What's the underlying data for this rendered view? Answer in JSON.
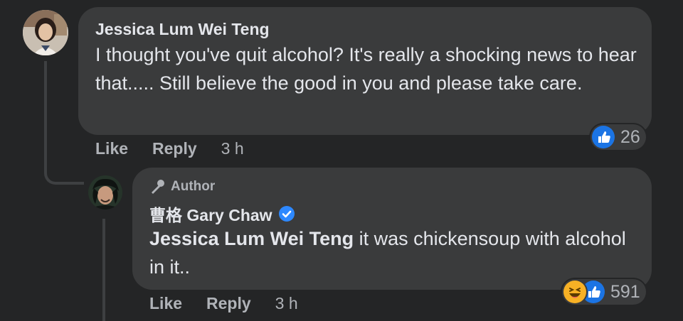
{
  "comment": {
    "author": "Jessica Lum Wei Teng",
    "text": "I thought you've quit alcohol? It's really a shocking news to hear that..... Still believe the good in you and please take care.",
    "reactions": {
      "icons": [
        "like-icon"
      ],
      "count": "26"
    },
    "actions": {
      "like": "Like",
      "reply": "Reply",
      "time": "3 h"
    }
  },
  "reply": {
    "badge": "Author",
    "author": "曹格 Gary Chaw",
    "mention": "Jessica Lum Wei Teng",
    "text": " it was chickensoup with alcohol in it..",
    "reactions": {
      "icons": [
        "haha-icon",
        "like-icon"
      ],
      "count": "591"
    },
    "actions": {
      "like": "Like",
      "reply": "Reply",
      "time": "3 h"
    }
  },
  "colors": {
    "background": "#242526",
    "bubble": "#3a3b3c",
    "text_primary": "#e4e6eb",
    "text_secondary": "#b0b3b8",
    "like_blue": "#1b74e4",
    "verified_blue": "#2d88ff",
    "haha_yellow": "#f7b125"
  }
}
